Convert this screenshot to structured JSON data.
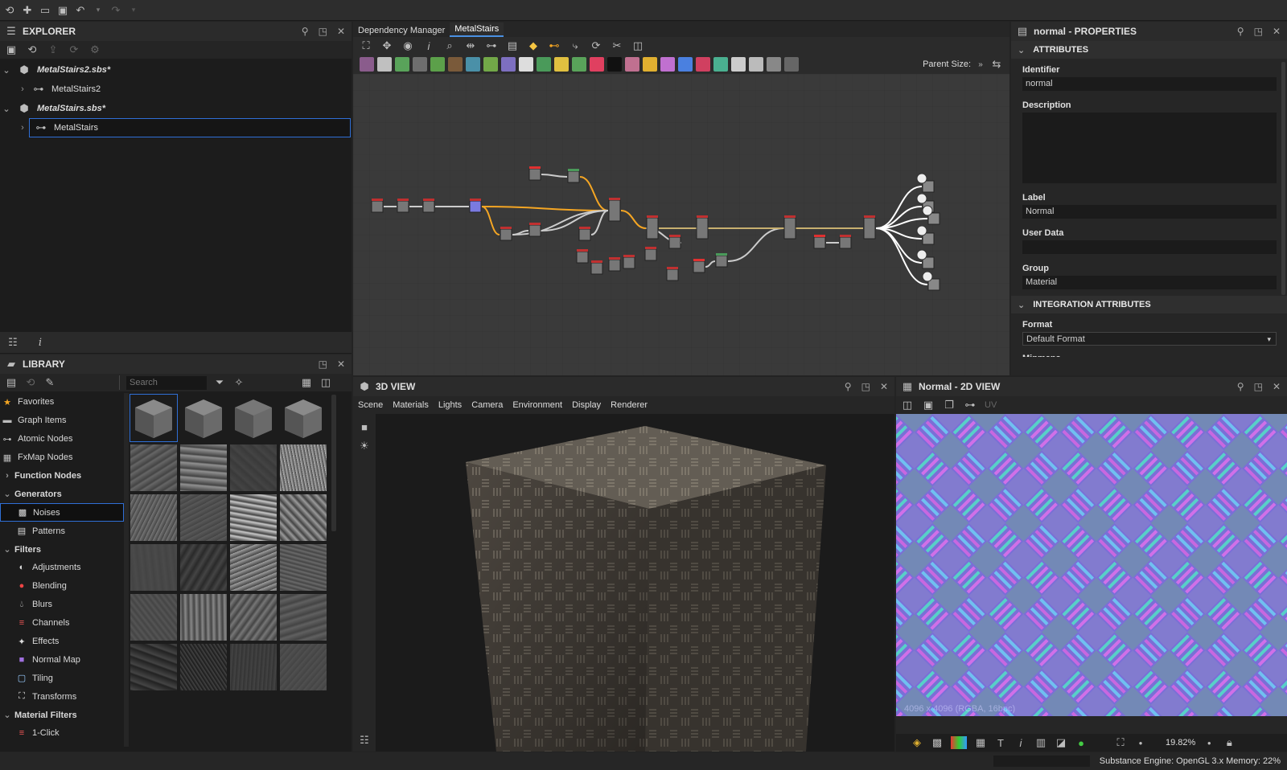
{
  "explorer": {
    "title": "EXPLORER",
    "tree": [
      {
        "label": "MetalStairs2.sbs*",
        "type": "package"
      },
      {
        "label": "MetalStairs2",
        "type": "graph"
      },
      {
        "label": "MetalStairs.sbs*",
        "type": "package"
      },
      {
        "label": "MetalStairs",
        "type": "graph",
        "selected": true
      }
    ]
  },
  "library": {
    "title": "LIBRARY",
    "search_placeholder": "Search",
    "categories": [
      {
        "label": "Favorites",
        "icon": "star-icon",
        "head": false
      },
      {
        "label": "Graph Items",
        "icon": "comment-icon",
        "head": false
      },
      {
        "label": "Atomic Nodes",
        "icon": "atomic-icon",
        "head": false
      },
      {
        "label": "FxMap Nodes",
        "icon": "fxmap-icon",
        "head": false
      },
      {
        "label": "Function Nodes",
        "icon": "",
        "head": true,
        "chev": "›"
      },
      {
        "label": "Generators",
        "icon": "",
        "head": true,
        "chev": "⌄"
      },
      {
        "label": "Noises",
        "icon": "noise-icon",
        "sub": true,
        "selected": true
      },
      {
        "label": "Patterns",
        "icon": "pattern-icon",
        "sub": true
      },
      {
        "label": "Filters",
        "icon": "",
        "head": true,
        "chev": "⌄"
      },
      {
        "label": "Adjustments",
        "icon": "adjust-icon",
        "sub": true
      },
      {
        "label": "Blending",
        "icon": "blend-icon",
        "sub": true
      },
      {
        "label": "Blurs",
        "icon": "blur-icon",
        "sub": true
      },
      {
        "label": "Channels",
        "icon": "channels-icon",
        "sub": true
      },
      {
        "label": "Effects",
        "icon": "effects-icon",
        "sub": true
      },
      {
        "label": "Normal Map",
        "icon": "normalmap-icon",
        "sub": true
      },
      {
        "label": "Tiling",
        "icon": "tiling-icon",
        "sub": true
      },
      {
        "label": "Transforms",
        "icon": "transform-icon",
        "sub": true
      },
      {
        "label": "Material Filters",
        "icon": "",
        "head": true,
        "chev": "⌄"
      },
      {
        "label": "1-Click",
        "icon": "oneclick-icon",
        "sub": true
      }
    ]
  },
  "graph": {
    "tabs": [
      "Dependency Manager",
      "MetalStairs"
    ],
    "active_tab": "MetalStairs",
    "parent_size_label": "Parent Size:"
  },
  "properties": {
    "title": "normal - PROPERTIES",
    "attributes_title": "ATTRIBUTES",
    "identifier_label": "Identifier",
    "identifier_value": "normal",
    "description_label": "Description",
    "label_label": "Label",
    "label_value": "Normal",
    "userdata_label": "User Data",
    "group_label": "Group",
    "group_value": "Material",
    "integration_title": "INTEGRATION ATTRIBUTES",
    "format_label": "Format",
    "format_value": "Default Format",
    "mipmaps_label": "Mipmaps"
  },
  "view3d": {
    "title": "3D VIEW",
    "menu": [
      "Scene",
      "Materials",
      "Lights",
      "Camera",
      "Environment",
      "Display",
      "Renderer"
    ]
  },
  "view2d": {
    "title": "Normal - 2D VIEW",
    "uv_label": "UV",
    "info": "4096 x 4096 (RGBA, 16bpc)",
    "zoom": "19.82%"
  },
  "status": {
    "text": "Substance Engine: OpenGL 3.x  Memory: 22%"
  }
}
